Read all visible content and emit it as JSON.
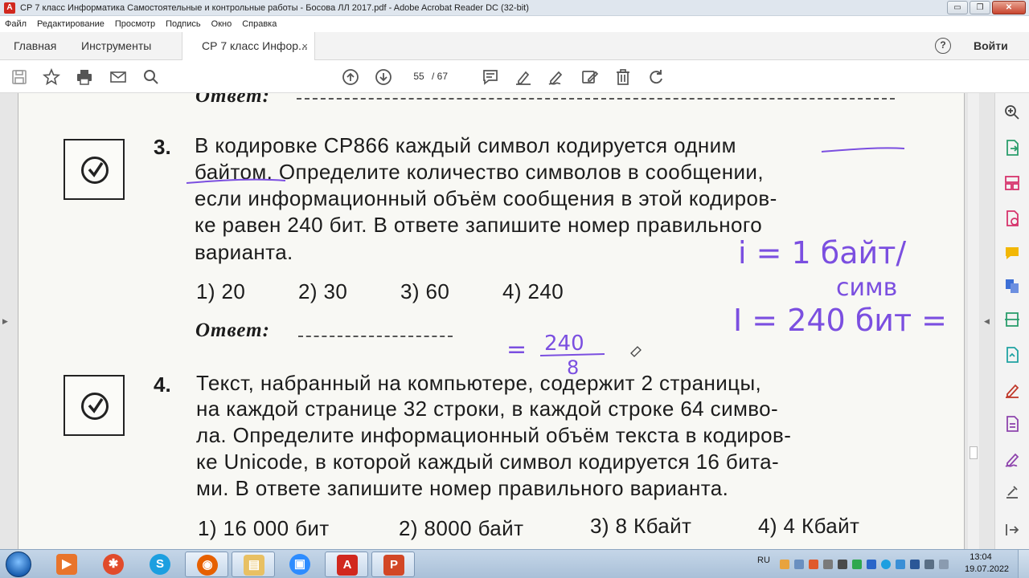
{
  "window": {
    "title": "СР 7 класс Информатика Самостоятельные и контрольные работы - Босова ЛЛ 2017.pdf - Adobe Acrobat Reader DC (32-bit)",
    "buttons": {
      "minimize": "▭",
      "maximize": "❐",
      "close": "✕"
    }
  },
  "menu": [
    "Файл",
    "Редактирование",
    "Просмотр",
    "Подпись",
    "Окно",
    "Справка"
  ],
  "tabs": {
    "home": "Главная",
    "tools": "Инструменты",
    "doc": "СР 7 класс Инфор...",
    "close": "×"
  },
  "header": {
    "help": "?",
    "signin": "Войти"
  },
  "toolbar": {
    "page_current": "55",
    "page_total": "/ 67",
    "icons": [
      "save-icon",
      "star-icon",
      "print-icon",
      "email-icon",
      "zoom-icon",
      "page-up-icon",
      "page-down-icon",
      "comment-icon",
      "highlight-icon",
      "sign-icon",
      "fill-sign-icon",
      "delete-icon",
      "undo-icon"
    ]
  },
  "document": {
    "prev_answer_label": "Ответ:",
    "q3": {
      "number": "3.",
      "lines": [
        "В кодировке СР866 каждый символ кодируется одним",
        "байтом. Определите количество символов в сообщении,",
        "если информационный объём сообщения в этой кодиров-",
        "ке равен 240 бит. В ответе запишите номер правильного",
        "варианта."
      ],
      "options": [
        "1) 20",
        "2) 30",
        "3) 60",
        "4) 240"
      ],
      "answer_label": "Ответ:"
    },
    "q4": {
      "number": "4.",
      "lines": [
        "Текст, набранный на компьютере, содержит 2 страницы,",
        "на каждой странице 32 строки, в каждой строке 64 симво-",
        "ла. Определите информационный объём текста в кодиров-",
        "ке Unicode, в которой каждый символ кодируется 16 бита-",
        "ми. В ответе запишите номер правильного варианта."
      ],
      "options": [
        "1) 16 000 бит",
        "2) 8000 байт",
        "3) 8 Кбайт",
        "4) 4 Кбайт"
      ]
    },
    "handwriting": {
      "line1": "i = 1 байт/",
      "line2": "симв",
      "line3": "I = 240 бит =",
      "fraction_prefix": "=",
      "numerator": "240",
      "denominator": "8",
      "ink_color": "#7b4fe0"
    }
  },
  "right_panel_icons": [
    "zoom-in-icon",
    "export-pdf-icon",
    "organize-pages-icon",
    "create-pdf-icon",
    "comment-icon",
    "combine-icon",
    "scan-icon",
    "send-icon",
    "fill-sign-icon",
    "edit-pdf-icon",
    "sign-icon",
    "tools-more-icon",
    "collapse-icon"
  ],
  "taskbar": {
    "apps": [
      "media-player",
      "app-dots",
      "skype",
      "firefox",
      "explorer",
      "zoom",
      "acrobat",
      "presentation"
    ],
    "lang": "RU",
    "time": "13:04",
    "date": "19.07.2022"
  },
  "colors": {
    "accent": "#1b5fb0",
    "acrobat_red": "#d1281e",
    "ink": "#7b4fe0"
  }
}
